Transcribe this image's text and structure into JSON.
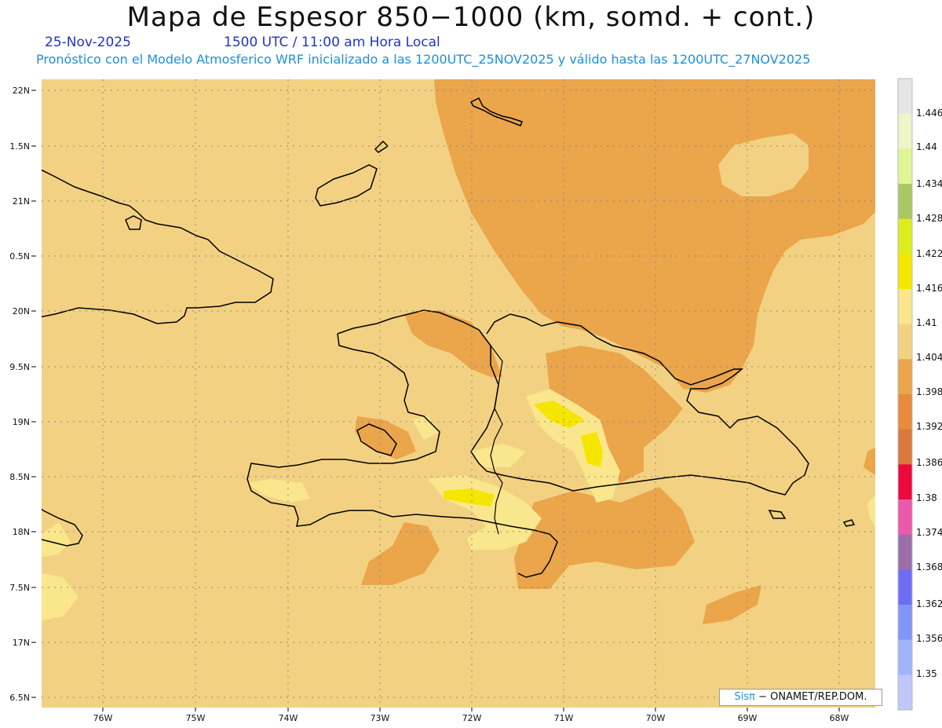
{
  "header": {
    "title": "Mapa de Espesor 850−1000 (km, somd. + cont.)",
    "date": "25-Nov-2025",
    "time": "1500 UTC / 11:00 am Hora Local",
    "forecast": "Pronóstico con el Modelo Atmosferico WRF inicializado a las 1200UTC_25NOV2025 y válido hasta las  1200UTC_27NOV2025"
  },
  "axes": {
    "lat_labels": [
      "22N",
      "1.5N",
      "21N",
      "0.5N",
      "20N",
      "9.5N",
      "19N",
      "8.5N",
      "18N",
      "7.5N",
      "17N",
      "6.5N"
    ],
    "lon_labels": [
      "76W",
      "75W",
      "74W",
      "73W",
      "72W",
      "71W",
      "70W",
      "69W",
      "68W"
    ]
  },
  "colorbar": {
    "labels": [
      "1.446",
      "1.44",
      "1.434",
      "1.428",
      "1.422",
      "1.416",
      "1.41",
      "1.404",
      "1.398",
      "1.392",
      "1.386",
      "1.38",
      "1.374",
      "1.368",
      "1.362",
      "1.356",
      "1.35"
    ],
    "colors": [
      "#e6e6e6",
      "#f0f5c8",
      "#e1f596",
      "#a8c864",
      "#dced1e",
      "#f5e600",
      "#fae68c",
      "#f2d282",
      "#eba54b",
      "#e68c3c",
      "#dc783c",
      "#eb0a3c",
      "#eb5aaa",
      "#9b6eaa",
      "#6e6ef5",
      "#8296fa",
      "#a0b4fa",
      "#bec8fa"
    ]
  },
  "map_colors": {
    "base": "#f2d282",
    "warm": "#eba54b",
    "warmer": "#e68c3c",
    "light": "#fae68c",
    "yellow": "#f5e600",
    "coast": "#000000"
  },
  "credit": {
    "brand": "Sisπ",
    "text": " − ONAMET/REP.DOM."
  }
}
